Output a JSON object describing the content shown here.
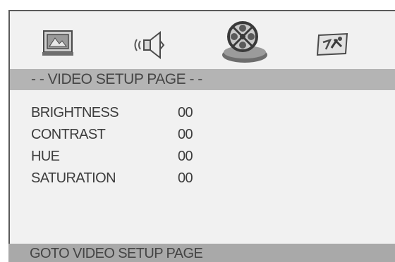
{
  "menu": {
    "tabs": [
      {
        "name": "general-setup",
        "icon": "general-setup-icon",
        "selected": false
      },
      {
        "name": "audio-setup",
        "icon": "speaker-icon",
        "selected": false
      },
      {
        "name": "video-setup",
        "icon": "film-reel-icon",
        "selected": true
      },
      {
        "name": "preference",
        "icon": "preference-icon",
        "selected": false
      }
    ],
    "title": "- - VIDEO SETUP PAGE - -",
    "items": [
      {
        "label": "BRIGHTNESS",
        "value": "00"
      },
      {
        "label": "CONTRAST",
        "value": "00"
      },
      {
        "label": "HUE",
        "value": "00"
      },
      {
        "label": "SATURATION",
        "value": "00"
      }
    ],
    "status": "GOTO VIDEO SETUP PAGE"
  },
  "colors": {
    "panel": "#f1f1f1",
    "title_bar": "#b4b4b4",
    "status_bar": "#a9a9a9",
    "text": "#3d3d3d"
  }
}
